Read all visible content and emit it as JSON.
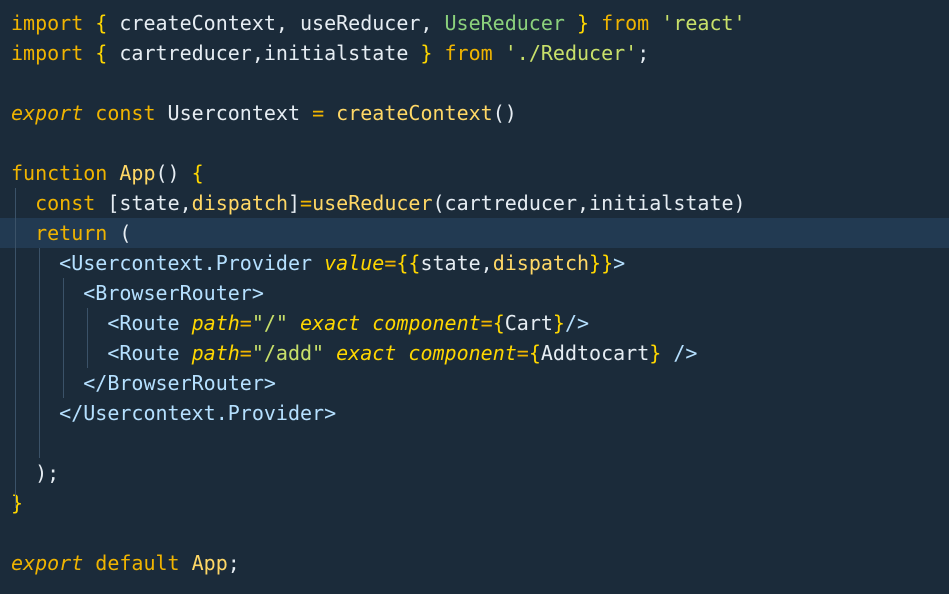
{
  "lines": [
    [
      [
        "kw",
        "import"
      ],
      [
        "pun",
        " "
      ],
      [
        "brk",
        "{"
      ],
      [
        "id",
        " createContext, useReducer, "
      ],
      [
        "cls",
        "UseReducer"
      ],
      [
        "pun",
        " "
      ],
      [
        "brk",
        "}"
      ],
      [
        "pun",
        " "
      ],
      [
        "kw",
        "from"
      ],
      [
        "pun",
        " "
      ],
      [
        "str",
        "'react'"
      ]
    ],
    [
      [
        "kw",
        "import"
      ],
      [
        "pun",
        " "
      ],
      [
        "brk",
        "{"
      ],
      [
        "id",
        " cartreducer,initialstate "
      ],
      [
        "brk",
        "}"
      ],
      [
        "pun",
        " "
      ],
      [
        "kw",
        "from"
      ],
      [
        "pun",
        " "
      ],
      [
        "str",
        "'./Reducer'"
      ],
      [
        "pun",
        ";"
      ]
    ],
    [],
    [
      [
        "kwi",
        "export"
      ],
      [
        "pun",
        " "
      ],
      [
        "kw",
        "const"
      ],
      [
        "id",
        " Usercontext "
      ],
      [
        "op",
        "="
      ],
      [
        "pun",
        " "
      ],
      [
        "fn",
        "createContext"
      ],
      [
        "pun",
        "()"
      ]
    ],
    [],
    [
      [
        "kw",
        "function"
      ],
      [
        "pun",
        " "
      ],
      [
        "fn",
        "App"
      ],
      [
        "pun",
        "() "
      ],
      [
        "brk",
        "{"
      ]
    ],
    [
      [
        "pun",
        "  "
      ],
      [
        "kw",
        "const"
      ],
      [
        "pun",
        " "
      ],
      [
        "pun",
        "["
      ],
      [
        "id",
        "state,"
      ],
      [
        "fn",
        "dispatch"
      ],
      [
        "pun",
        "]"
      ],
      [
        "op",
        "="
      ],
      [
        "fn",
        "useReducer"
      ],
      [
        "pun",
        "("
      ],
      [
        "id",
        "cartreducer,initialstate"
      ],
      [
        "pun",
        ")"
      ]
    ],
    [
      [
        "pun",
        "  "
      ],
      [
        "kw",
        "return"
      ],
      [
        "pun",
        " "
      ],
      [
        "pun",
        "("
      ]
    ],
    [
      [
        "pun",
        "    "
      ],
      [
        "tag",
        "<Usercontext.Provider"
      ],
      [
        "pun",
        " "
      ],
      [
        "attr",
        "value"
      ],
      [
        "op",
        "="
      ],
      [
        "brk",
        "{{"
      ],
      [
        "id",
        "state,"
      ],
      [
        "fn",
        "dispatch"
      ],
      [
        "brk",
        "}}"
      ],
      [
        "tag",
        ">"
      ]
    ],
    [
      [
        "pun",
        "      "
      ],
      [
        "tag",
        "<BrowserRouter>"
      ]
    ],
    [
      [
        "pun",
        "        "
      ],
      [
        "tag",
        "<Route"
      ],
      [
        "pun",
        " "
      ],
      [
        "attr",
        "path"
      ],
      [
        "op",
        "="
      ],
      [
        "str",
        "\"/\""
      ],
      [
        "pun",
        " "
      ],
      [
        "attr",
        "exact"
      ],
      [
        "pun",
        " "
      ],
      [
        "attr",
        "component"
      ],
      [
        "op",
        "="
      ],
      [
        "brk",
        "{"
      ],
      [
        "id",
        "Cart"
      ],
      [
        "brk",
        "}"
      ],
      [
        "tag",
        "/>"
      ]
    ],
    [
      [
        "pun",
        "        "
      ],
      [
        "tag",
        "<Route"
      ],
      [
        "pun",
        " "
      ],
      [
        "attr",
        "path"
      ],
      [
        "op",
        "="
      ],
      [
        "str",
        "\"/add\""
      ],
      [
        "pun",
        " "
      ],
      [
        "attr",
        "exact"
      ],
      [
        "pun",
        " "
      ],
      [
        "attr",
        "component"
      ],
      [
        "op",
        "="
      ],
      [
        "brk",
        "{"
      ],
      [
        "id",
        "Addtocart"
      ],
      [
        "brk",
        "}"
      ],
      [
        "pun",
        " "
      ],
      [
        "tag",
        "/>"
      ]
    ],
    [
      [
        "pun",
        "      "
      ],
      [
        "tag",
        "</BrowserRouter>"
      ]
    ],
    [
      [
        "pun",
        "    "
      ],
      [
        "tag",
        "</Usercontext.Provider>"
      ]
    ],
    [],
    [
      [
        "pun",
        "  "
      ],
      [
        "pun",
        ");"
      ]
    ],
    [
      [
        "brk",
        "}"
      ]
    ],
    [],
    [
      [
        "kwi",
        "export"
      ],
      [
        "pun",
        " "
      ],
      [
        "kw",
        "default"
      ],
      [
        "pun",
        " "
      ],
      [
        "fn",
        "App"
      ],
      [
        "pun",
        ";"
      ]
    ]
  ],
  "current_line": 7,
  "colors": {
    "background": "#1b2b3a",
    "current_line": "#223a52"
  }
}
